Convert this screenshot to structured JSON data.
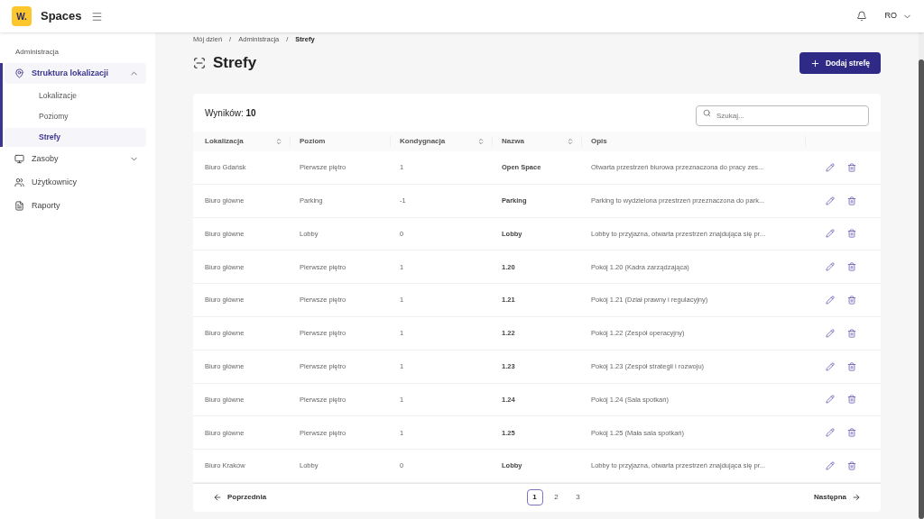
{
  "header": {
    "logo": "W.",
    "app_name": "Spaces",
    "user_initials": "RO"
  },
  "sidebar": {
    "section_title": "Administracja",
    "items": [
      {
        "label": "Struktura lokalizacji",
        "kind": "pin",
        "expanded": true,
        "selected": true,
        "children": [
          {
            "label": "Lokalizacje",
            "selected": false
          },
          {
            "label": "Poziomy",
            "selected": false
          },
          {
            "label": "Strefy",
            "selected": true
          }
        ]
      },
      {
        "label": "Zasoby",
        "kind": "desk",
        "expanded": false,
        "selected": false
      },
      {
        "label": "Użytkownicy",
        "kind": "users",
        "selected": false
      },
      {
        "label": "Raporty",
        "kind": "report",
        "selected": false
      }
    ]
  },
  "breadcrumb": {
    "items": [
      "Mój dzień",
      "Administracja",
      "Strefy"
    ],
    "separator": "/"
  },
  "page_title": "Strefy",
  "add_button": "Dodaj strefę",
  "results_label": "Wyników:",
  "results_count": "10",
  "search": {
    "placeholder": "Szukaj..."
  },
  "table": {
    "columns": [
      {
        "label": "Lokalizacja",
        "sortable": true
      },
      {
        "label": "Poziom",
        "sortable": false
      },
      {
        "label": "Kondygnacja",
        "sortable": true
      },
      {
        "label": "Nazwa",
        "sortable": true
      },
      {
        "label": "Opis",
        "sortable": false
      }
    ],
    "rows": [
      [
        "Biuro Gdańsk",
        "Pierwsze piętro",
        "1",
        "Open Space",
        "Otwarta przestrzeń biurowa przeznaczona do pracy zes..."
      ],
      [
        "Biuro główne",
        "Parking",
        "-1",
        "Parking",
        "Parking to wydzielona przestrzeń przeznaczona do park..."
      ],
      [
        "Biuro główne",
        "Lobby",
        "0",
        "Lobby",
        "Lobby to przyjazna, otwarta przestrzeń znajdująca się pr..."
      ],
      [
        "Biuro główne",
        "Pierwsze piętro",
        "1",
        "1.20",
        "Pokój 1.20 (Kadra zarządzająca)"
      ],
      [
        "Biuro główne",
        "Pierwsze piętro",
        "1",
        "1.21",
        "Pokój 1.21 (Dział prawny i regulacyjny)"
      ],
      [
        "Biuro główne",
        "Pierwsze piętro",
        "1",
        "1.22",
        "Pokój 1.22 (Zespół operacyjny)"
      ],
      [
        "Biuro główne",
        "Pierwsze piętro",
        "1",
        "1.23",
        "Pokój 1.23 (Zespół strategii i rozwoju)"
      ],
      [
        "Biuro główne",
        "Pierwsze piętro",
        "1",
        "1.24",
        "Pokój 1.24 (Sala spotkań)"
      ],
      [
        "Biuro główne",
        "Pierwsze piętro",
        "1",
        "1.25",
        "Pokój 1.25 (Mała sala spotkań)"
      ],
      [
        "Biuro Kraków",
        "Lobby",
        "0",
        "Lobby",
        "Lobby to przyjazna, otwarta przestrzeń znajdująca się pr..."
      ]
    ]
  },
  "pagination": {
    "previous": "Poprzednia",
    "next": "Następna",
    "pages": [
      {
        "label": "1",
        "selected": true
      },
      {
        "label": "2",
        "selected": false
      },
      {
        "label": "3",
        "selected": false
      }
    ]
  }
}
